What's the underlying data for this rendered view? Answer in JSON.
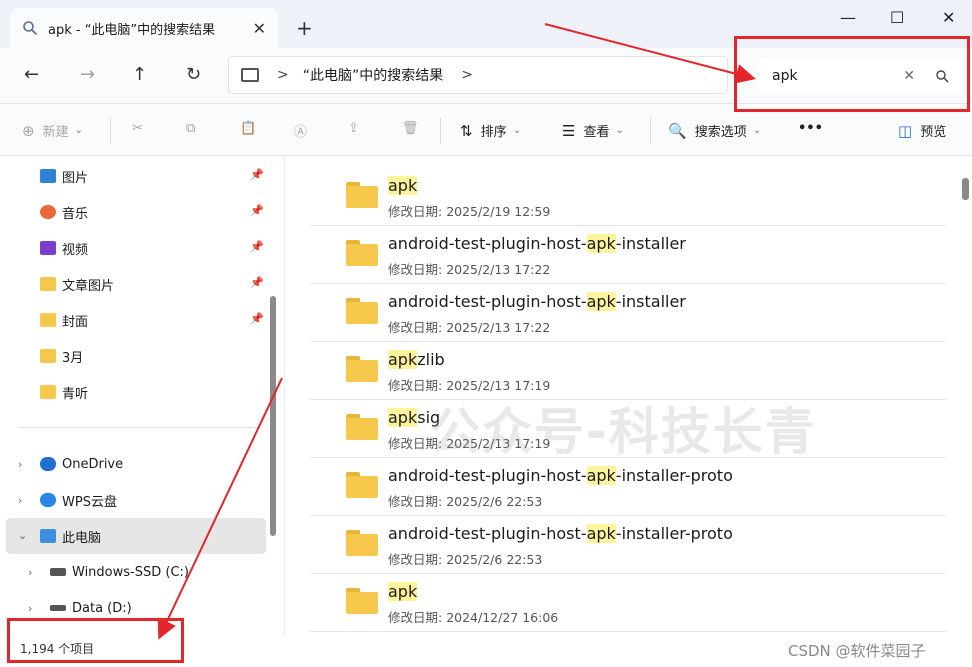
{
  "tab": {
    "title": "apk - “此电脑”中的搜索结果",
    "close": "✕",
    "new": "+",
    "icon": "search-icon"
  },
  "window_controls": {
    "minimize": "—",
    "maximize": "☐",
    "close": "✕"
  },
  "nav": {
    "back": "←",
    "forward": "→",
    "up": "↑",
    "refresh": "↻",
    "breadcrumb": "“此电脑”中的搜索结果",
    "sep": ">",
    "sep2": ">"
  },
  "search": {
    "value": "apk",
    "clear": "✕",
    "icon": "⌕"
  },
  "toolbar": {
    "new_label": "新建",
    "sort_label": "排序",
    "view_label": "查看",
    "search_options_label": "搜索选项",
    "more_label": "•••",
    "preview_label": "预览"
  },
  "sidebar": {
    "quick": [
      {
        "label": "图片",
        "icon": "pictures-icon"
      },
      {
        "label": "音乐",
        "icon": "music-icon"
      },
      {
        "label": "视频",
        "icon": "videos-icon"
      },
      {
        "label": "文章图片",
        "icon": "folder-icon"
      },
      {
        "label": "封面",
        "icon": "folder-icon"
      },
      {
        "label": "3月",
        "icon": "folder-icon"
      },
      {
        "label": "青听",
        "icon": "folder-icon"
      }
    ],
    "tree": [
      {
        "label": "OneDrive",
        "icon": "cloud-icon"
      },
      {
        "label": "WPS云盘",
        "icon": "cloud-icon"
      },
      {
        "label": "此电脑",
        "icon": "computer-icon"
      },
      {
        "label": "Windows-SSD (C:)",
        "icon": "drive-icon"
      },
      {
        "label": "Data (D:)",
        "icon": "drive-icon"
      }
    ]
  },
  "status": {
    "count": "1,194 个项目"
  },
  "results": [
    {
      "pre": "",
      "hl": "apk",
      "post": "",
      "date_label": "修改日期:",
      "date": "2025/2/19 12:59"
    },
    {
      "pre": "android-test-plugin-host-",
      "hl": "apk",
      "post": "-installer",
      "date_label": "修改日期:",
      "date": "2025/2/13 17:22"
    },
    {
      "pre": "android-test-plugin-host-",
      "hl": "apk",
      "post": "-installer",
      "date_label": "修改日期:",
      "date": "2025/2/13 17:22"
    },
    {
      "pre": "",
      "hl": "apk",
      "post": "zlib",
      "date_label": "修改日期:",
      "date": "2025/2/13 17:19"
    },
    {
      "pre": "",
      "hl": "apk",
      "post": "sig",
      "date_label": "修改日期:",
      "date": "2025/2/13 17:19"
    },
    {
      "pre": "android-test-plugin-host-",
      "hl": "apk",
      "post": "-installer-proto",
      "date_label": "修改日期:",
      "date": "2025/2/6 22:53"
    },
    {
      "pre": "android-test-plugin-host-",
      "hl": "apk",
      "post": "-installer-proto",
      "date_label": "修改日期:",
      "date": "2025/2/6 22:53"
    },
    {
      "pre": "",
      "hl": "apk",
      "post": "",
      "date_label": "修改日期:",
      "date": "2024/12/27 16:06"
    }
  ],
  "watermark": "公众号-科技长青",
  "credit": "CSDN @软件菜园子",
  "colors": {
    "annotation_red": "#e3262a",
    "highlight": "#fdf49b",
    "folder": "#f6c94d"
  }
}
